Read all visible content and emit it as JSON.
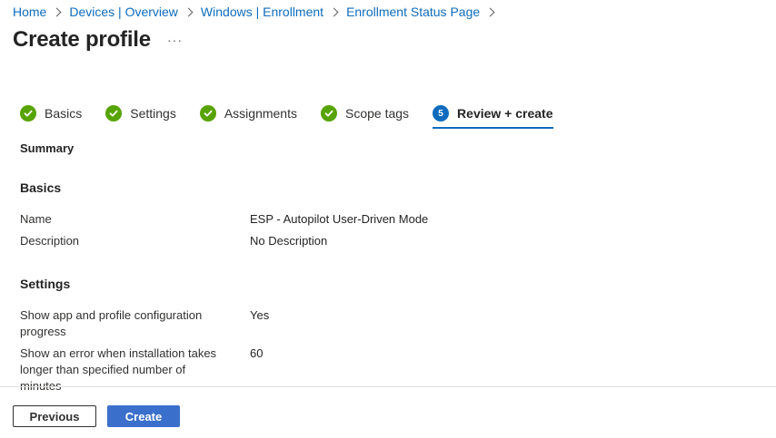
{
  "breadcrumb": {
    "items": [
      "Home",
      "Devices | Overview",
      "Windows | Enrollment",
      "Enrollment Status Page"
    ]
  },
  "page": {
    "title": "Create profile",
    "more_label": "···"
  },
  "wizard": {
    "steps": [
      {
        "label": "Basics",
        "state": "complete"
      },
      {
        "label": "Settings",
        "state": "complete"
      },
      {
        "label": "Assignments",
        "state": "complete"
      },
      {
        "label": "Scope tags",
        "state": "complete"
      },
      {
        "label": "Review + create",
        "state": "active",
        "number": "5"
      }
    ]
  },
  "summary": {
    "heading": "Summary",
    "basics": {
      "heading": "Basics",
      "rows": [
        {
          "key": "Name",
          "value": "ESP - Autopilot User-Driven Mode"
        },
        {
          "key": "Description",
          "value": "No Description"
        }
      ]
    },
    "settings": {
      "heading": "Settings",
      "rows": [
        {
          "key": "Show app and profile configuration progress",
          "value": "Yes"
        },
        {
          "key": "Show an error when installation takes longer than specified number of minutes",
          "value": "60"
        }
      ]
    }
  },
  "footer": {
    "previous_label": "Previous",
    "create_label": "Create"
  },
  "colors": {
    "link": "#0f6cbd",
    "check": "#57a300",
    "primary_button": "#3b6fcc",
    "active_step": "#0f6cbd"
  }
}
